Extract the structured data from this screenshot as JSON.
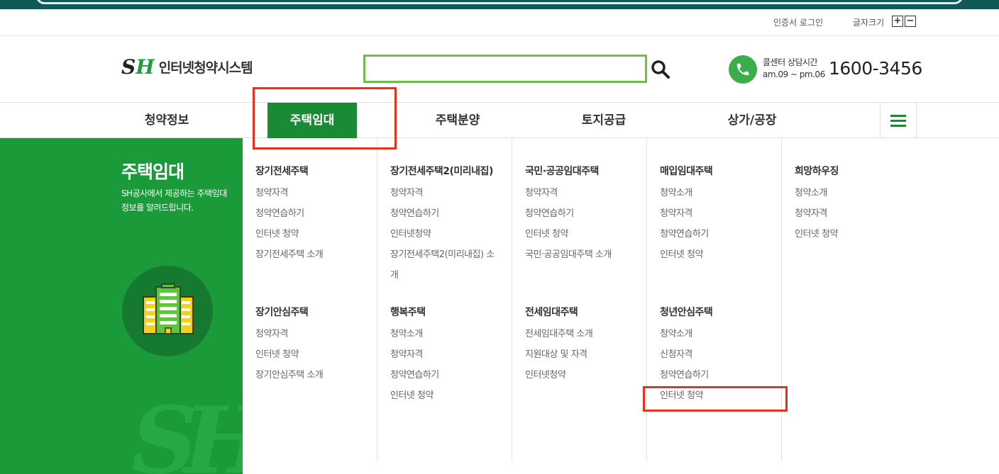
{
  "util": {
    "cert_login": "인증서 로그인",
    "font_size": "글자크기",
    "plus": "+",
    "minus": "−"
  },
  "logo": {
    "mark_s": "S",
    "mark_h": "H",
    "text": "인터넷청약시스템"
  },
  "search": {
    "value": "",
    "placeholder": ""
  },
  "callcenter": {
    "label": "콜센터 상담시간",
    "hours": "am.09 ~ pm.06",
    "phone": "1600-3456"
  },
  "gnb": [
    {
      "label": "청약정보"
    },
    {
      "label": "주택임대"
    },
    {
      "label": "주택분양"
    },
    {
      "label": "토지공급"
    },
    {
      "label": "상가/공장"
    }
  ],
  "panel": {
    "title": "주택임대",
    "desc": "SH공사에서 제공하는 주택임대 정보를 알려드립니다.",
    "watermark": "SH"
  },
  "columns": [
    {
      "groups": [
        {
          "title": "장기전세주택",
          "links": [
            "청약자격",
            "청약연습하기",
            "인터넷 청약",
            "장기전세주택 소개"
          ]
        },
        {
          "title": "장기안심주택",
          "links": [
            "청약자격",
            "인터넷 청약",
            "장기안심주택 소개"
          ]
        }
      ]
    },
    {
      "groups": [
        {
          "title": "장기전세주택2(미리내집)",
          "links": [
            "청약자격",
            "청약연습하기",
            "인터넷청약",
            "장기전세주택2(미리내집) 소",
            "개"
          ]
        },
        {
          "title": "행복주택",
          "links": [
            "청약소개",
            "청약자격",
            "청약연습하기",
            "인터넷 청약"
          ]
        }
      ]
    },
    {
      "groups": [
        {
          "title": "국민·공공임대주택",
          "links": [
            "청약자격",
            "청약연습하기",
            "인터넷 청약",
            "국민·공공임대주택 소개"
          ]
        },
        {
          "title": "전세임대주택",
          "links": [
            "전세임대주택 소개",
            "지원대상 및 자격",
            "인터넷청약"
          ]
        }
      ]
    },
    {
      "groups": [
        {
          "title": "매입임대주택",
          "links": [
            "청약소개",
            "청약자격",
            "청약연습하기",
            "인터넷 청약"
          ]
        },
        {
          "title": "청년안심주택",
          "links": [
            "청약소개",
            "신청자격",
            "청약연습하기",
            "인터넷 청약"
          ]
        }
      ]
    },
    {
      "groups": [
        {
          "title": "희망하우징",
          "links": [
            "청약소개",
            "청약자격",
            "인터넷 청약"
          ]
        }
      ]
    }
  ],
  "colors": {
    "brand_green": "#1b8a34",
    "panel_green": "#1b9a3a",
    "highlight_red": "#e8321e",
    "search_border": "#6cc04a"
  }
}
